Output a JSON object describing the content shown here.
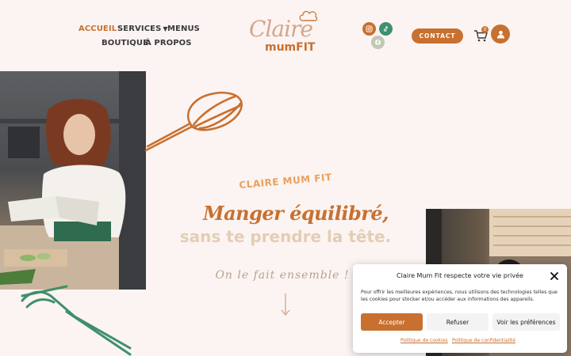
{
  "colors": {
    "accent": "#c8702f",
    "light_accent": "#eaa15c",
    "pale": "#e4cdb4",
    "green": "#3f8f6c",
    "background": "#fbf4f2"
  },
  "nav": {
    "items": [
      {
        "label": "ACCUEIL",
        "active": true
      },
      {
        "label": "SERVICES",
        "has_dropdown": true
      },
      {
        "label": "MENUS"
      },
      {
        "label": "BOUTIQUE"
      },
      {
        "label": "À PROPOS"
      }
    ]
  },
  "logo": {
    "script": "Claire",
    "sub": "mumFIT"
  },
  "social": [
    {
      "icon": "instagram-icon",
      "color": "#c8702f"
    },
    {
      "icon": "tiktok-icon",
      "color": "#3f8f6c"
    },
    {
      "icon": "facebook-icon",
      "color": "#bfc8b4"
    }
  ],
  "header": {
    "contact_label": "CONTACT",
    "cart_count": "0"
  },
  "hero": {
    "kicker": "CLAIRE MUM FIT",
    "headline_line1": "Manger équilibré,",
    "headline_line2": "sans te prendre la tête.",
    "tagline": "On le fait ensemble !"
  },
  "cookie": {
    "title": "Claire Mum Fit respecte votre vie privée",
    "body": "Pour offrir les meilleures expériences, nous utilisons des technologies telles que les cookies pour stocker et/ou accéder aux informations des appareils.",
    "accept_label": "Accepter",
    "refuse_label": "Refuser",
    "prefs_label": "Voir les préférences",
    "cookie_policy_label": "Politique de cookies",
    "privacy_policy_label": "Politique de confidentialité"
  }
}
